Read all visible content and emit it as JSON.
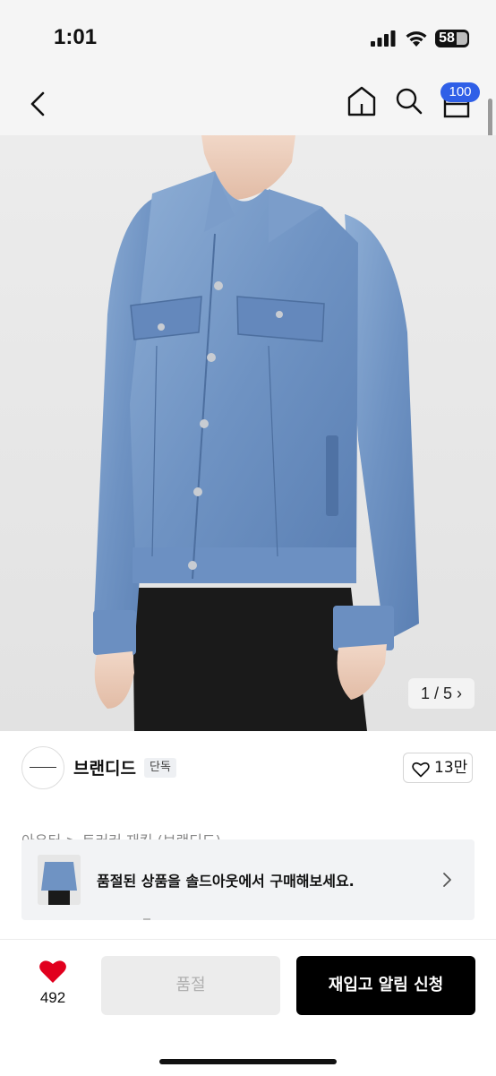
{
  "status_bar": {
    "time": "1:01",
    "battery": "58"
  },
  "header": {
    "icons": [
      "back-chevron-icon",
      "home-icon",
      "search-icon",
      "cart-icon"
    ],
    "cart_badge": "100",
    "badge_color": "#2f5fe7"
  },
  "gallery": {
    "counter": "1 / 5",
    "image_subject": "light-wash blue denim trucker jacket"
  },
  "brand": {
    "name": "브랜디드",
    "tag": "단독",
    "likes": "13만"
  },
  "breadcrumb": "아우터 > 트러커 재킷 (브랜디드)",
  "soldout_banner": {
    "text": "품절된 상품을 솔드아웃에서 구매해보세요."
  },
  "bottom_bar": {
    "wish_count": "492",
    "wish_color": "#e1001e",
    "soldout_label": "품절",
    "restock_label": "재입고 알림 신청"
  }
}
